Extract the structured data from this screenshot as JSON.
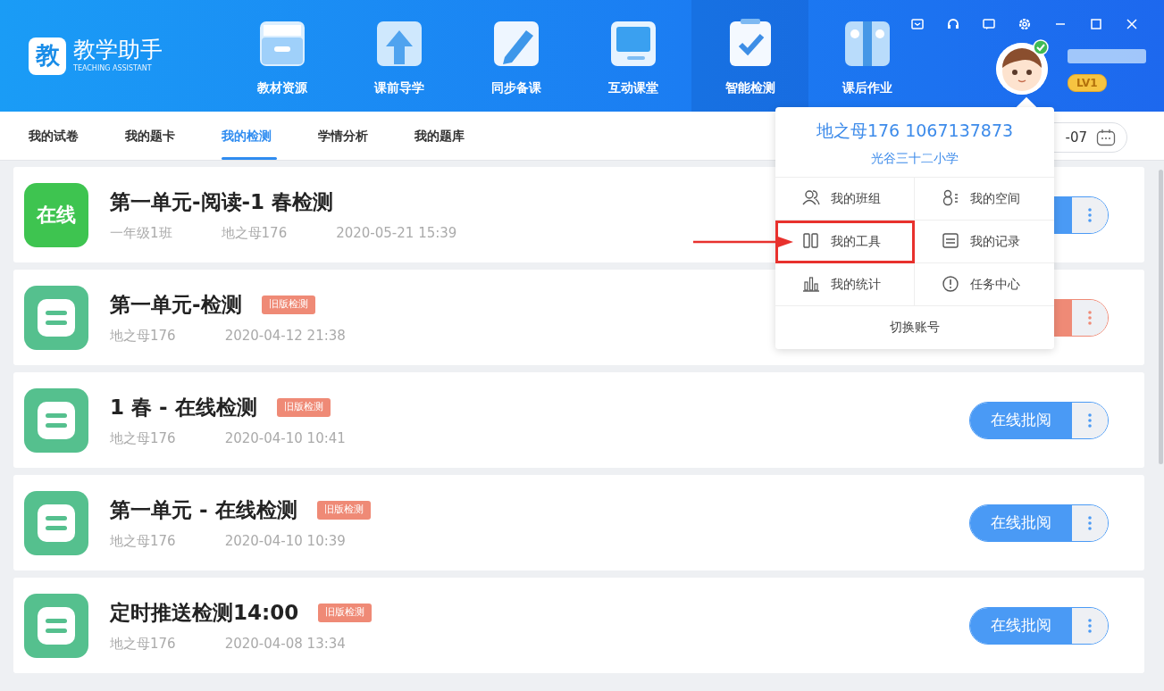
{
  "app": {
    "logo_char": "教",
    "name": "教学助手",
    "subtitle": "TEACHING ASSISTANT"
  },
  "nav": [
    {
      "label": "教材资源",
      "selected": false
    },
    {
      "label": "课前导学",
      "selected": false
    },
    {
      "label": "同步备课",
      "selected": false
    },
    {
      "label": "互动课堂",
      "selected": false
    },
    {
      "label": "智能检测",
      "selected": true
    },
    {
      "label": "课后作业",
      "selected": false
    }
  ],
  "user": {
    "level_badge": "LV1",
    "verified": true
  },
  "tabs": [
    {
      "label": "我的试卷",
      "selected": false
    },
    {
      "label": "我的题卡",
      "selected": false
    },
    {
      "label": "我的检测",
      "selected": true
    },
    {
      "label": "学情分析",
      "selected": false
    },
    {
      "label": "我的题库",
      "selected": false
    }
  ],
  "date_field": {
    "value": "-07"
  },
  "items": [
    {
      "kind": "online",
      "icon_text": "在线",
      "title": "第一单元-阅读-1 春检测",
      "meta": [
        "一年级1班",
        "地之母176",
        "2020-05-21 15:39"
      ],
      "button": {
        "color": "#4a9af5"
      }
    },
    {
      "kind": "sheet",
      "title": "第一单元-检测",
      "tag": "旧版检测",
      "meta": [
        "地之母176",
        "2020-04-12 21:38"
      ],
      "button": {
        "color": "#ef8a76"
      }
    },
    {
      "kind": "sheet",
      "title": "1 春 - 在线检测",
      "tag": "旧版检测",
      "meta": [
        "地之母176",
        "2020-04-10 10:41"
      ],
      "button": {
        "label": "在线批阅",
        "color": "#4a9af5"
      }
    },
    {
      "kind": "sheet",
      "title": "第一单元 - 在线检测",
      "tag": "旧版检测",
      "meta": [
        "地之母176",
        "2020-04-10 10:39"
      ],
      "button": {
        "label": "在线批阅",
        "color": "#4a9af5"
      }
    },
    {
      "kind": "sheet",
      "title": "定时推送检测14:00",
      "tag": "旧版检测",
      "meta": [
        "地之母176",
        "2020-04-08 13:34"
      ],
      "button": {
        "label": "在线批阅",
        "color": "#4a9af5"
      }
    }
  ],
  "popup": {
    "account": "地之母176 1067137873",
    "school": "光谷三十二小学",
    "items": [
      {
        "label": "我的班组",
        "highlighted": false
      },
      {
        "label": "我的空间",
        "highlighted": false
      },
      {
        "label": "我的工具",
        "highlighted": true
      },
      {
        "label": "我的记录",
        "highlighted": false
      },
      {
        "label": "我的统计",
        "highlighted": false
      },
      {
        "label": "任务中心",
        "highlighted": false
      }
    ],
    "footer": "切换账号"
  }
}
